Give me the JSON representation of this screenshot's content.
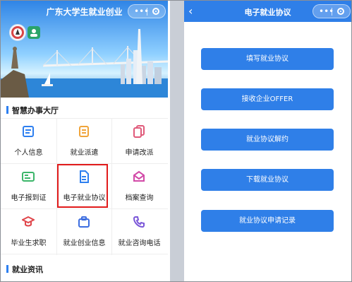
{
  "left_app": {
    "title": "广东大学生就业创业",
    "section_main": "智慧办事大厅",
    "services": [
      {
        "label": "个人信息",
        "icon": "id-card-icon"
      },
      {
        "label": "就业派遣",
        "icon": "document-icon"
      },
      {
        "label": "申请改派",
        "icon": "copy-docs-icon"
      },
      {
        "label": "电子报到证",
        "icon": "report-card-icon"
      },
      {
        "label": "电子就业协议",
        "icon": "agreement-icon"
      },
      {
        "label": "档案查询",
        "icon": "mail-icon"
      },
      {
        "label": "毕业生求职",
        "icon": "grad-cap-icon"
      },
      {
        "label": "就业创业信息",
        "icon": "briefcase-icon"
      },
      {
        "label": "就业咨询电话",
        "icon": "phone-icon"
      }
    ],
    "section_news": "就业资讯"
  },
  "right_app": {
    "title": "电子就业协议",
    "buttons": [
      "填写就业协议",
      "接收企业OFFER",
      "就业协议解约",
      "下载就业协议",
      "就业协议申请记录"
    ]
  },
  "capsule": {
    "dots": "•••"
  },
  "colors": {
    "accent": "#2f7fe8",
    "highlight": "#e11b1b"
  }
}
